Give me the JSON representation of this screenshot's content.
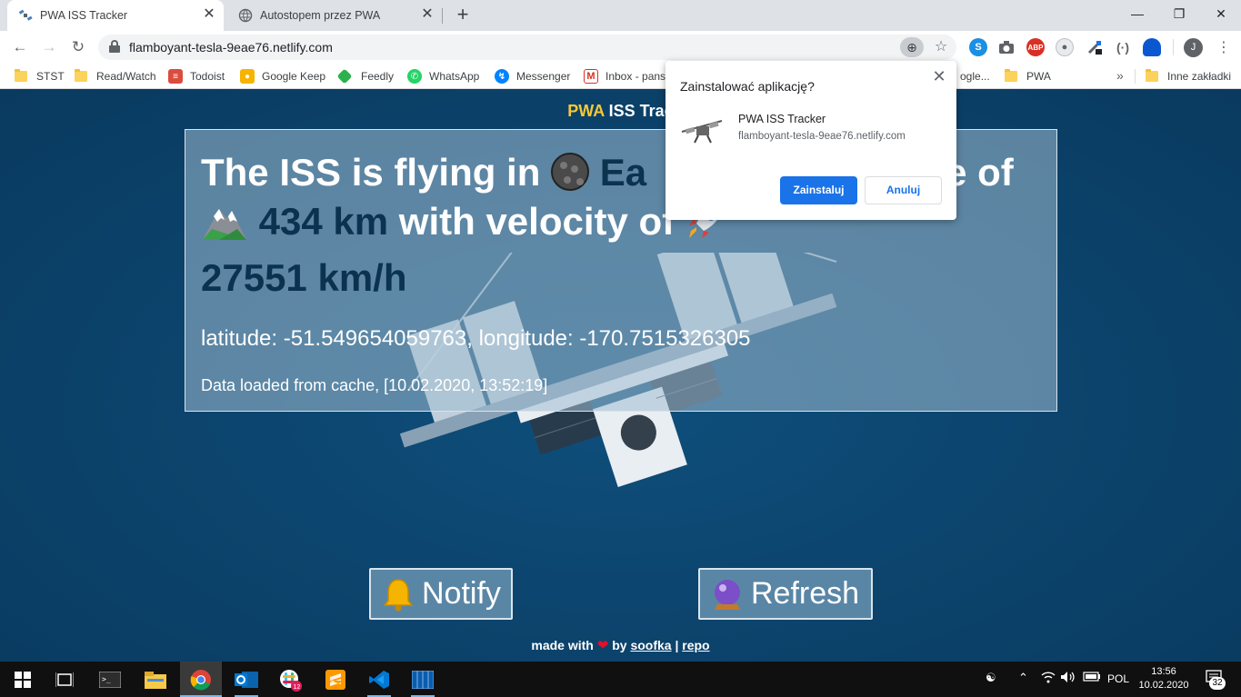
{
  "browser": {
    "tabs": [
      {
        "title": "PWA ISS Tracker",
        "close": "✕"
      },
      {
        "title": "Autostopem przez PWA",
        "close": "✕"
      }
    ],
    "new_tab": "+",
    "window_controls": {
      "minimize": "—",
      "maximize": "❐",
      "close": "✕"
    },
    "url": "flamboyant-tesla-9eae76.netlify.com",
    "profile_initial": "J",
    "bookmarks": [
      "STST",
      "Read/Watch",
      "Todoist",
      "Google Keep",
      "Feedly",
      "WhatsApp",
      "Messenger",
      "Inbox - pans",
      "ogle...",
      "PWA",
      "Inne zakładki"
    ],
    "bookmarks_more": "»"
  },
  "page": {
    "title_accent": "PWA",
    "title_rest": " ISS Trac",
    "headline": {
      "part1": "The ISS is flying in ",
      "place": "Ea",
      "part2": "t the altitude of ",
      "altitude": "434 km",
      "part3": " with velocity of ",
      "velocity": "27551 km/h"
    },
    "coordinates": "latitude: -51.549654059763, longitude: -170.7515326305",
    "cache_note": "Data loaded from cache, [10.02.2020, 13:52:19]",
    "buttons": {
      "notify": "Notify",
      "refresh": "Refresh"
    },
    "footer": {
      "made_with": "made with",
      "by": "by",
      "author": "soofka",
      "separator": "|",
      "repo": "repo"
    }
  },
  "install_dialog": {
    "title": "Zainstalować aplikację?",
    "app_name": "PWA ISS Tracker",
    "app_url": "flamboyant-tesla-9eae76.netlify.com",
    "install_label": "Zainstaluj",
    "cancel_label": "Anuluj"
  },
  "taskbar": {
    "language": "POL",
    "time": "13:56",
    "date": "10.02.2020",
    "notifications": "32"
  },
  "colors": {
    "accent_yellow": "#f5c935",
    "chrome_blue": "#1a73e8",
    "page_background": "#0c4670",
    "highlight_text": "#0b3350"
  }
}
